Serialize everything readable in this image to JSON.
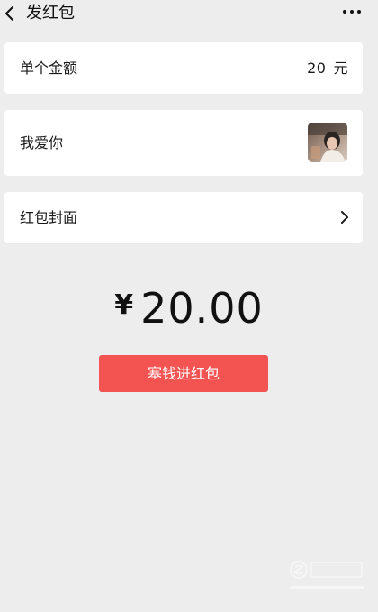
{
  "header": {
    "title": "发红包",
    "back_icon": "chevron-left-icon",
    "more_icon": "ellipsis-icon"
  },
  "amount_row": {
    "label": "单个金额",
    "value": "20",
    "unit": "元"
  },
  "message_row": {
    "label": "我爱你",
    "thumbnail": "photo-thumbnail"
  },
  "cover_row": {
    "label": "红包封面",
    "icon": "chevron-right-icon"
  },
  "total": {
    "currency": "¥",
    "amount": "20.00"
  },
  "send_button": {
    "label": "塞钱进红包",
    "color": "#f35452"
  },
  "colors": {
    "background": "#ededed",
    "card": "#ffffff",
    "accent": "#f35452"
  }
}
